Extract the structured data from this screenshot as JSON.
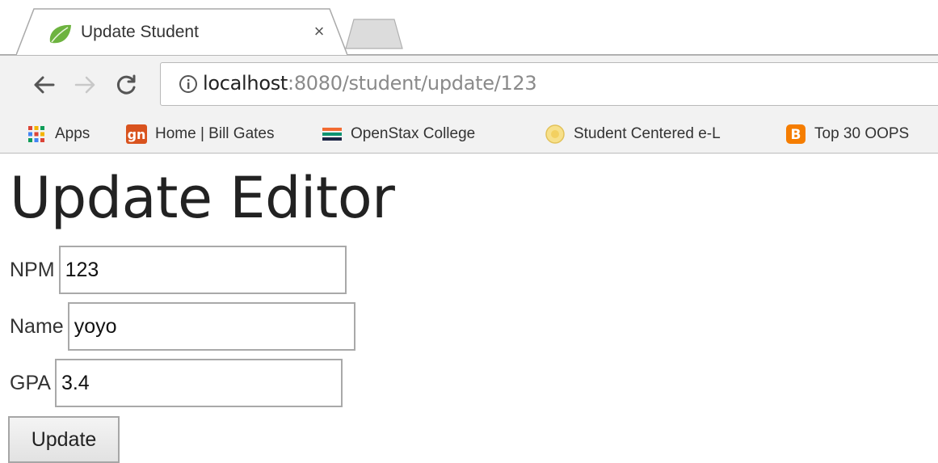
{
  "browser": {
    "tab": {
      "title": "Update Student",
      "favicon": "spring-leaf-icon",
      "close_label": "×"
    },
    "address": {
      "host": "localhost",
      "path": ":8080/student/update/123"
    },
    "bookmarks": [
      {
        "label": "Apps",
        "icon": "apps-grid-icon"
      },
      {
        "label": "Home | Bill Gates",
        "icon": "gn-icon"
      },
      {
        "label": "OpenStax College",
        "icon": "openstax-icon"
      },
      {
        "label": "Student Centered e-L",
        "icon": "seal-icon"
      },
      {
        "label": "Top 30 OOPS",
        "icon": "blogger-icon"
      }
    ]
  },
  "page": {
    "heading": "Update Editor",
    "fields": {
      "npm": {
        "label": "NPM",
        "value": "123"
      },
      "name": {
        "label": "Name",
        "value": "yoyo"
      },
      "gpa": {
        "label": "GPA",
        "value": "3.4"
      }
    },
    "submit_label": "Update"
  },
  "colors": {
    "blogger_orange": "#f57d00",
    "gn_orange": "#d9531e",
    "spring_green": "#6db33f"
  }
}
